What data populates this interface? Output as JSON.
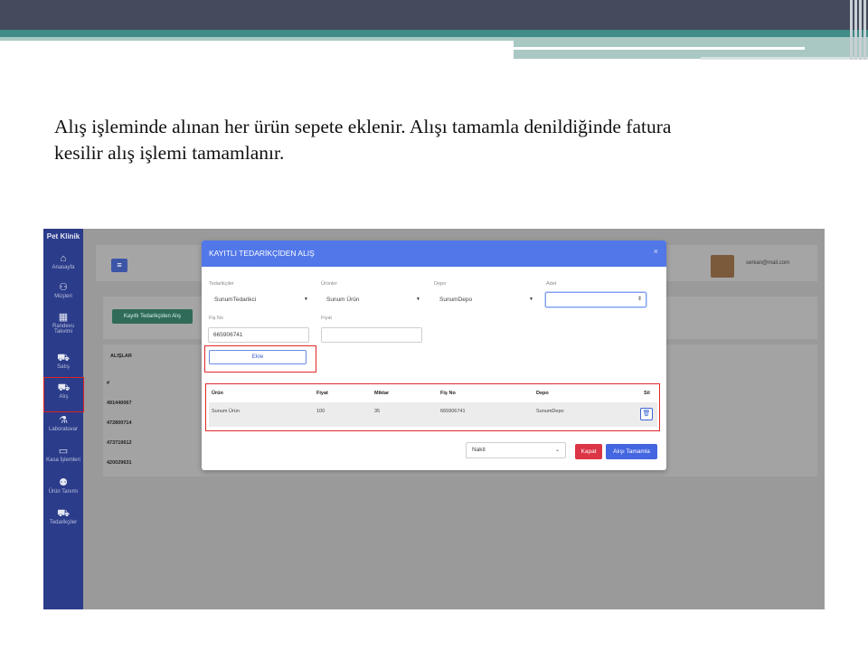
{
  "slide": {
    "text_line1": "Alış işleminde alınan her ürün sepete eklenir. Alışı tamamla denildiğinde fatura",
    "text_line2": "kesilir alış işlemi tamamlanır."
  },
  "app": {
    "brand": "Pet Klinik",
    "menu_icon": "≡",
    "user_email": "serkan@mail.com",
    "add_supplier_button": "Kayıtlı Tedarikçiden Alış",
    "sidebar": [
      {
        "label": "Anasayfa",
        "icon": "home-icon",
        "glyph": "⌂"
      },
      {
        "label": "Müşteri",
        "icon": "user-icon",
        "glyph": "⚇"
      },
      {
        "label": "Randevu Takvimi",
        "icon": "calendar-icon",
        "glyph": "▦"
      },
      {
        "label": "Satış",
        "icon": "basket-icon",
        "glyph": "⛟"
      },
      {
        "label": "Alış",
        "icon": "truck-icon",
        "glyph": "⛟"
      },
      {
        "label": "Laboratuvar",
        "icon": "flask-icon",
        "glyph": "⚗"
      },
      {
        "label": "Kasa İşlemleri",
        "icon": "cash-icon",
        "glyph": "▭"
      },
      {
        "label": "Ürün Tanımı",
        "icon": "people-icon",
        "glyph": "⚉"
      },
      {
        "label": "Tedarikçiler",
        "icon": "truck-icon",
        "glyph": "⛟"
      }
    ],
    "background_table": {
      "title": "ALIŞLAR",
      "header_col": "#",
      "rows": [
        "491440067",
        "472800714",
        "473719612",
        "420029631"
      ]
    }
  },
  "modal": {
    "title": "KAYITLI TEDARİKÇİDEN ALIŞ",
    "close": "×",
    "fields": {
      "supplier_label": "Tedarikçiler",
      "supplier_value": "SunumTedarikci",
      "product_label": "Ürünler",
      "product_value": "Sunum Ürün",
      "depot_label": "Depo",
      "depot_value": "SunumDepo",
      "quantity_label": "Adet",
      "quantity_value": "",
      "receipt_label": "Fiş No",
      "receipt_value": "665906741",
      "price_label": "Fiyat",
      "price_value": ""
    },
    "add_button": "Ekle",
    "table": {
      "columns": [
        "Ürün",
        "Fiyat",
        "Miktar",
        "Fiş No",
        "Depo",
        "Sil"
      ],
      "rows": [
        {
          "product": "Sunum Ürün",
          "price": "100",
          "quantity": "35",
          "receipt": "665906741",
          "depot": "SunumDepo"
        }
      ]
    },
    "payment_method": "Nakit",
    "close_button": "Kapat",
    "finish_button": "Alışı Tamamla"
  }
}
